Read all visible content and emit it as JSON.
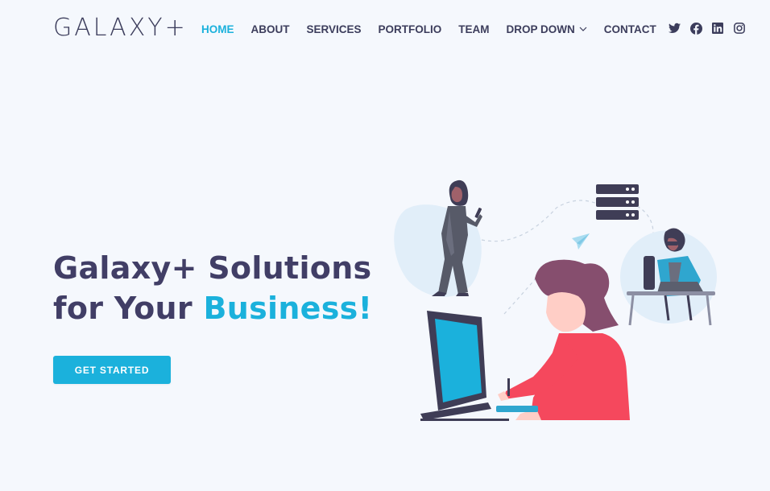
{
  "brand": {
    "logo_text": "GALAXY+"
  },
  "nav": {
    "items": [
      {
        "label": "HOME",
        "active": true
      },
      {
        "label": "ABOUT",
        "active": false
      },
      {
        "label": "SERVICES",
        "active": false
      },
      {
        "label": "PORTFOLIO",
        "active": false
      },
      {
        "label": "TEAM",
        "active": false
      },
      {
        "label": "DROP DOWN",
        "active": false,
        "has_dropdown": true
      },
      {
        "label": "CONTACT",
        "active": false
      }
    ]
  },
  "socials": [
    "twitter-icon",
    "facebook-icon",
    "linkedin-icon",
    "instagram-icon"
  ],
  "hero": {
    "title_line1": "Galaxy+ Solutions",
    "title_line2_prefix": "for Your ",
    "title_line2_accent": "Business!",
    "cta_label": "GET STARTED"
  },
  "colors": {
    "accent": "#1bb1dc",
    "heading": "#413e66",
    "text": "#3c3d5c",
    "background": "#f5f8fd"
  }
}
